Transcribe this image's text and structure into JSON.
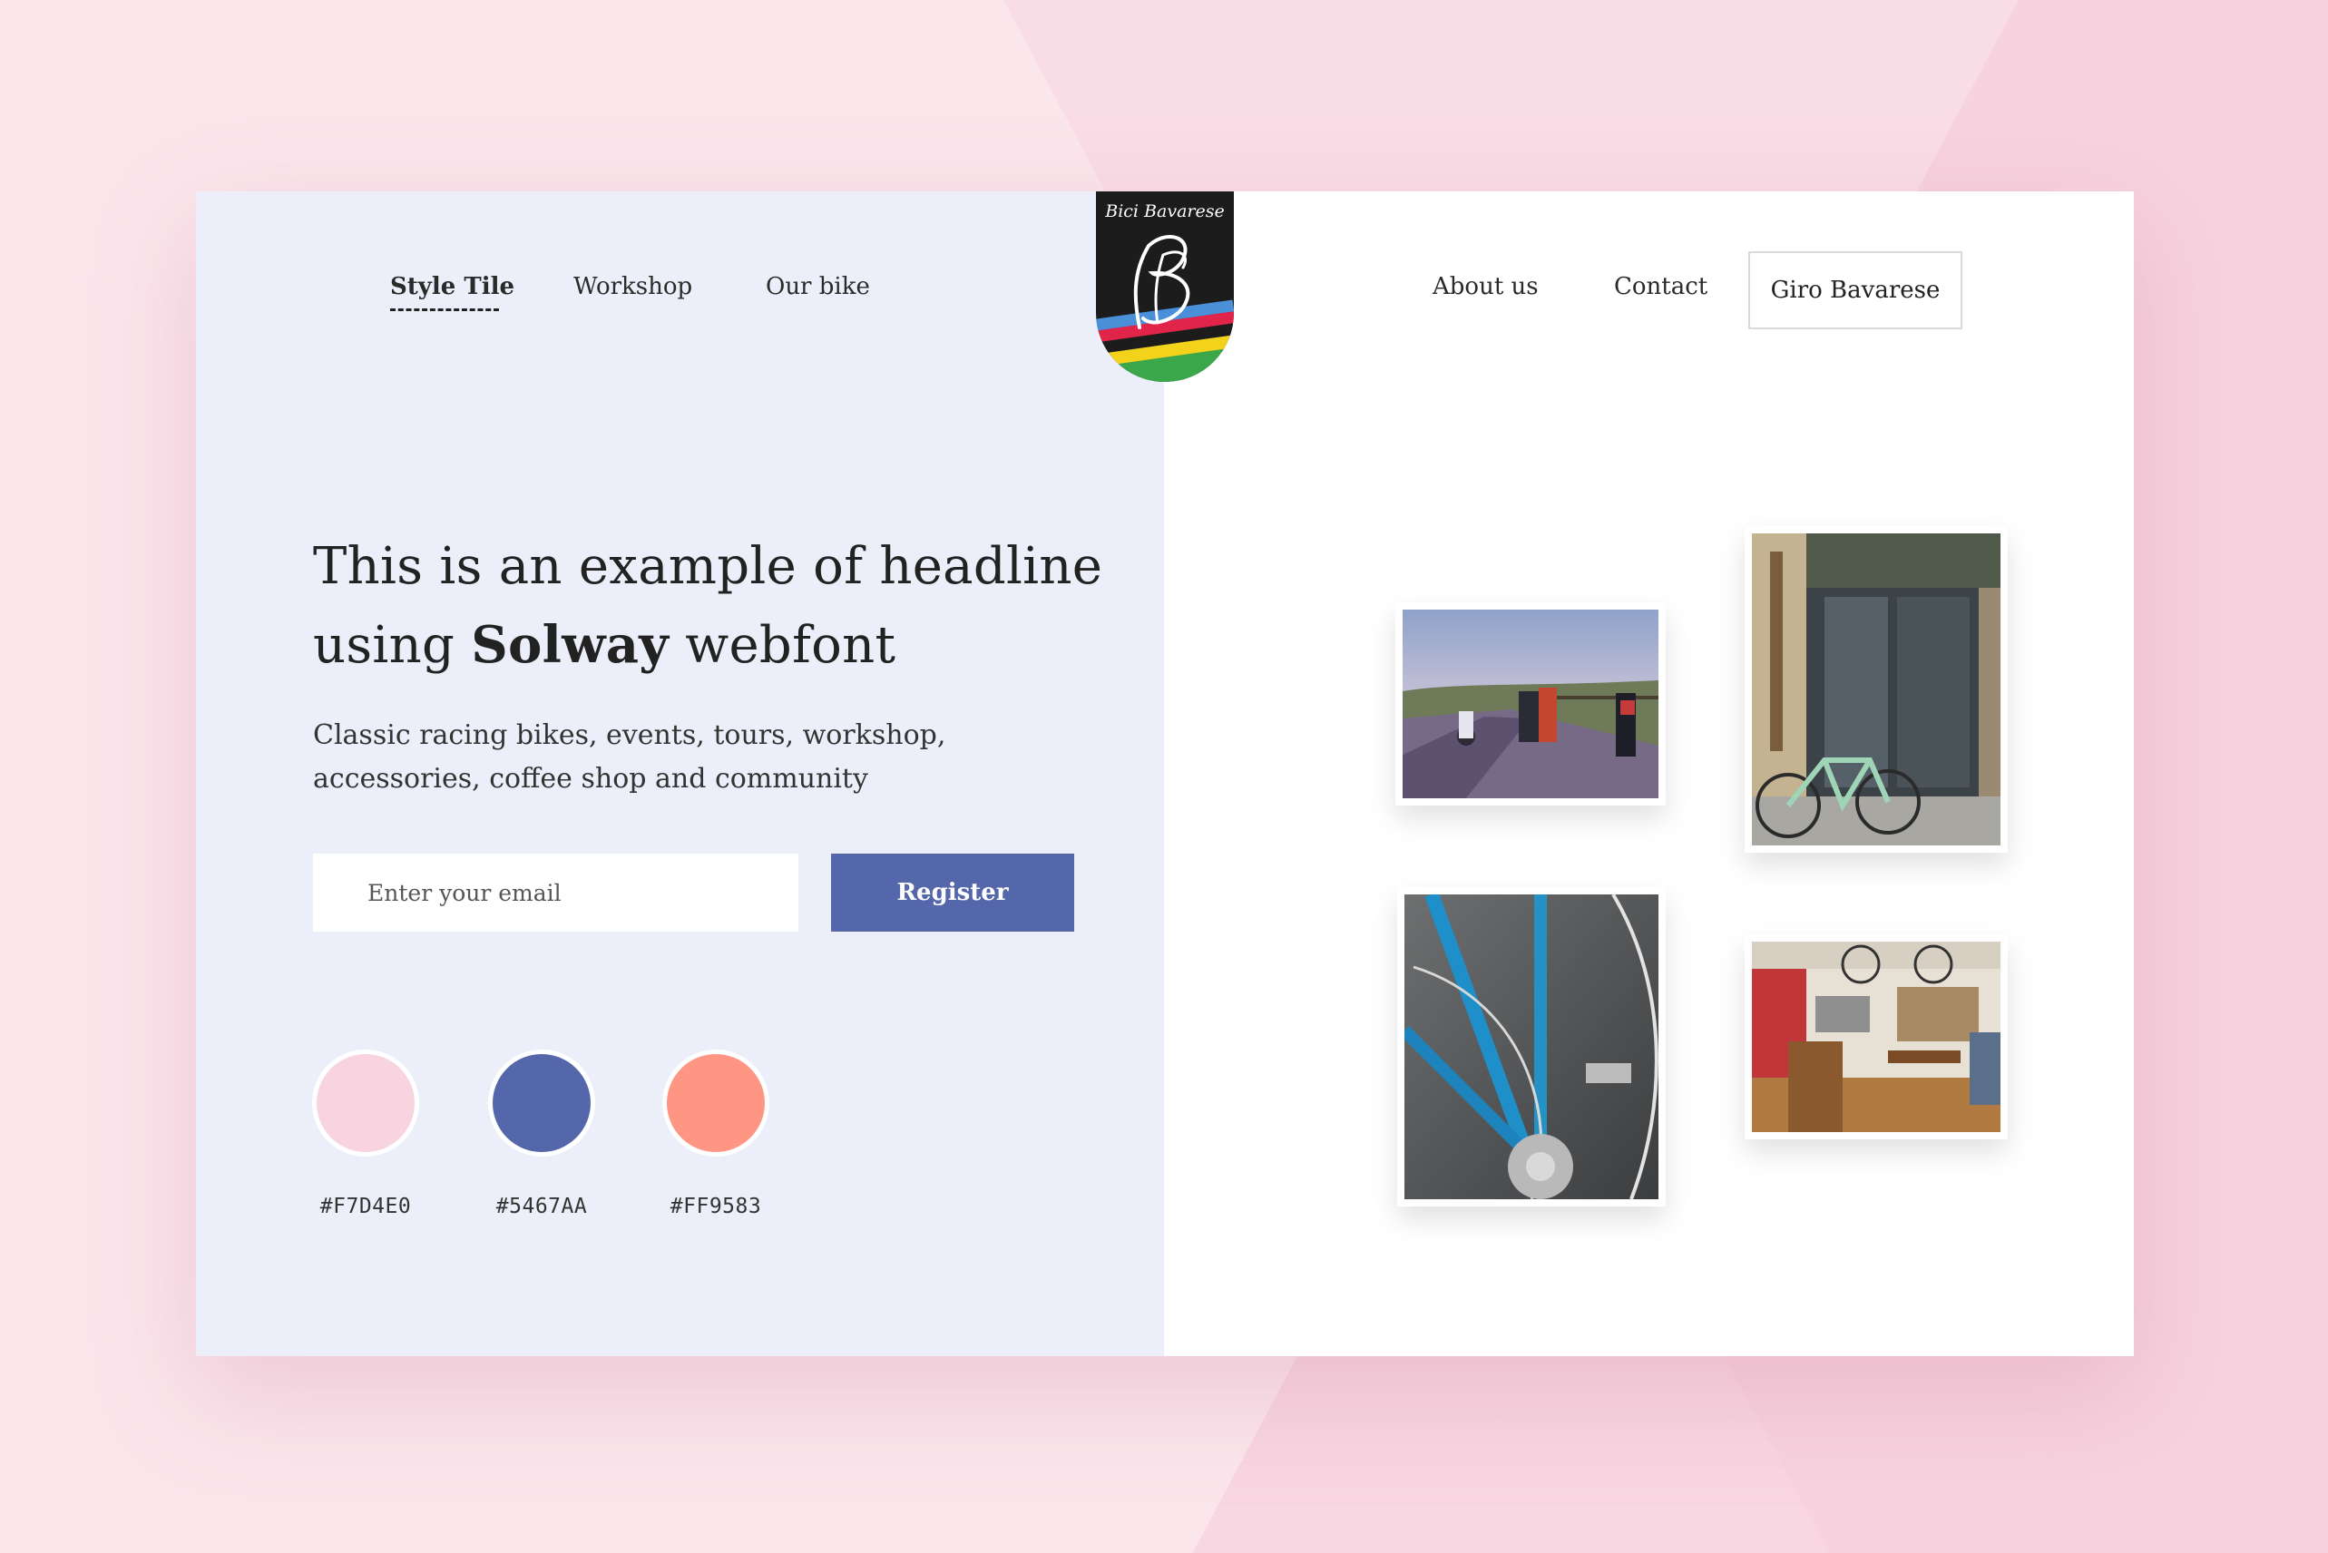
{
  "nav": {
    "left": [
      {
        "label": "Style Tile",
        "active": true
      },
      {
        "label": "Workshop"
      },
      {
        "label": "Our bike"
      }
    ],
    "right": [
      {
        "label": "About us"
      },
      {
        "label": "Contact"
      }
    ],
    "cta": "Giro Bavarese"
  },
  "logo": {
    "script_text": "Bici Bavarese",
    "icon": "bb-shield-logo"
  },
  "hero": {
    "headline_prefix": "This is an example of headline using ",
    "headline_bold": "Solway",
    "headline_suffix": " webfont",
    "subtext": "Classic racing bikes, events, tours, workshop, accessories, coffee shop and community"
  },
  "form": {
    "email_placeholder": "Enter your email",
    "register_label": "Register"
  },
  "palette": [
    {
      "hex": "#F7D4E0",
      "color": "#f7d4e0"
    },
    {
      "hex": "#5467AA",
      "color": "#5467aa"
    },
    {
      "hex": "#FF9583",
      "color": "#ff9583"
    }
  ],
  "photos": [
    {
      "name": "cyclists-on-road-photo"
    },
    {
      "name": "shop-entrance-bike-photo"
    },
    {
      "name": "blue-bike-frame-photo"
    },
    {
      "name": "cafe-interior-photo"
    }
  ]
}
